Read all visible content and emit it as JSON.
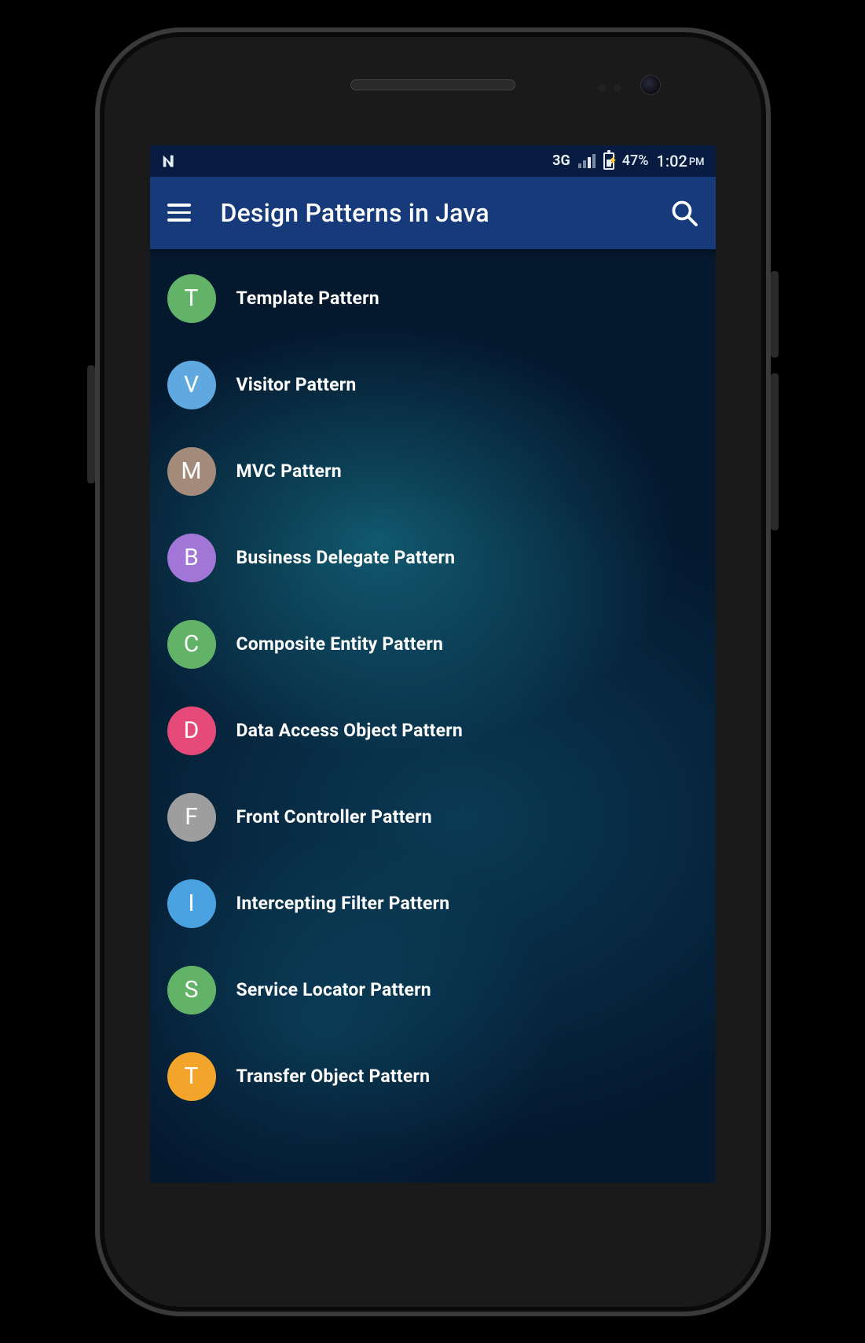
{
  "status_bar": {
    "network": "3G",
    "battery_pct": "47%",
    "time": "1:02",
    "time_suffix": "PM"
  },
  "app_bar": {
    "title": "Design Patterns in Java",
    "menu_icon": "menu-icon",
    "search_icon": "search-icon"
  },
  "list": {
    "items": [
      {
        "letter": "T",
        "label": "Template Pattern",
        "color": "#62b368"
      },
      {
        "letter": "V",
        "label": "Visitor Pattern",
        "color": "#5fa8e0"
      },
      {
        "letter": "M",
        "label": "MVC Pattern",
        "color": "#a38a7a"
      },
      {
        "letter": "B",
        "label": "Business Delegate Pattern",
        "color": "#a176d6"
      },
      {
        "letter": "C",
        "label": "Composite Entity Pattern",
        "color": "#62b368"
      },
      {
        "letter": "D",
        "label": "Data Access Object Pattern",
        "color": "#e64a78"
      },
      {
        "letter": "F",
        "label": "Front Controller Pattern",
        "color": "#9e9e9e"
      },
      {
        "letter": "I",
        "label": "Intercepting Filter Pattern",
        "color": "#4aa3e0"
      },
      {
        "letter": "S",
        "label": "Service Locator Pattern",
        "color": "#62b368"
      },
      {
        "letter": "T",
        "label": "Transfer Object Pattern",
        "color": "#f2a52a"
      }
    ]
  }
}
